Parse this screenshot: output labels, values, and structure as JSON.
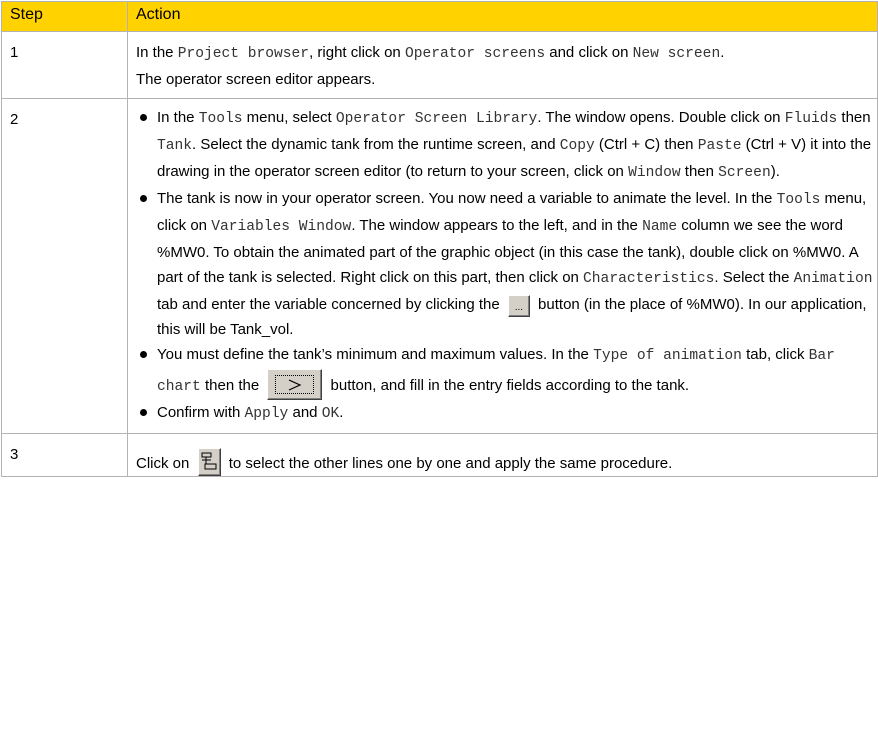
{
  "header": {
    "step": "Step",
    "action": "Action"
  },
  "step1": {
    "number": "1",
    "t1": "In the ",
    "m1": "Project browser",
    "t2": ", right click on ",
    "m2": "Operator screens",
    "t3": " and click on ",
    "m3": "New screen",
    "t4": ".",
    "line2": "The operator screen editor appears."
  },
  "step2": {
    "number": "2",
    "b1": {
      "t1": "In the ",
      "m1": "Tools",
      "t2": " menu, select ",
      "m2": "Operator Screen Library",
      "t3": ". The window opens. Double click on ",
      "m3": "Fluids",
      "t4": " then ",
      "m4": "Tank",
      "t5": ". Select the dynamic tank from the runtime screen, and ",
      "m5": "Copy",
      "t6": " (Ctrl + C) then ",
      "m6": "Paste",
      "t7": " (Ctrl + V) it into the drawing in the operator screen editor (to return to your screen, click on ",
      "m7": "Window",
      "t8": " then ",
      "m8": "Screen",
      "t9": ")."
    },
    "b2": {
      "t1": "The tank is now in your operator screen. You now need a variable to animate the level. In the ",
      "m1": "Tools",
      "t2": " menu, click on ",
      "m2": "Variables Window",
      "t3": ". The window appears to the left, and in the ",
      "m3": "Name",
      "t4": " column we see the word %MW0. To obtain the animated part of the graphic object (in this case the tank), double click on %MW0. A part of the tank is selected. Right click on this part, then click on ",
      "m4": "Characteristics",
      "t5": ". Select the ",
      "m5": "Animation",
      "t6": " tab and enter the variable concerned by clicking the ",
      "t7": " button (in the place of %MW0). In our application, this will be Tank_vol."
    },
    "b3": {
      "t1": "You must define the tank’s minimum and maximum values. In the ",
      "m1": "Type of animation",
      "t2": " tab, click ",
      "m2": "Bar chart",
      "t3": " then the ",
      "t4": " button, and fill in the entry fields according to the tank."
    },
    "b4": {
      "t1": "Confirm with ",
      "m1": "Apply",
      "t2": " and ",
      "m2": "OK",
      "t3": "."
    }
  },
  "step3": {
    "number": "3",
    "t1": "Click on ",
    "t2": " to select the other lines one by one and apply the same procedure."
  },
  "icons": {
    "browse": "browse-dots-button-icon",
    "next": "next-arrow-button-icon",
    "lines": "select-lines-button-icon"
  }
}
